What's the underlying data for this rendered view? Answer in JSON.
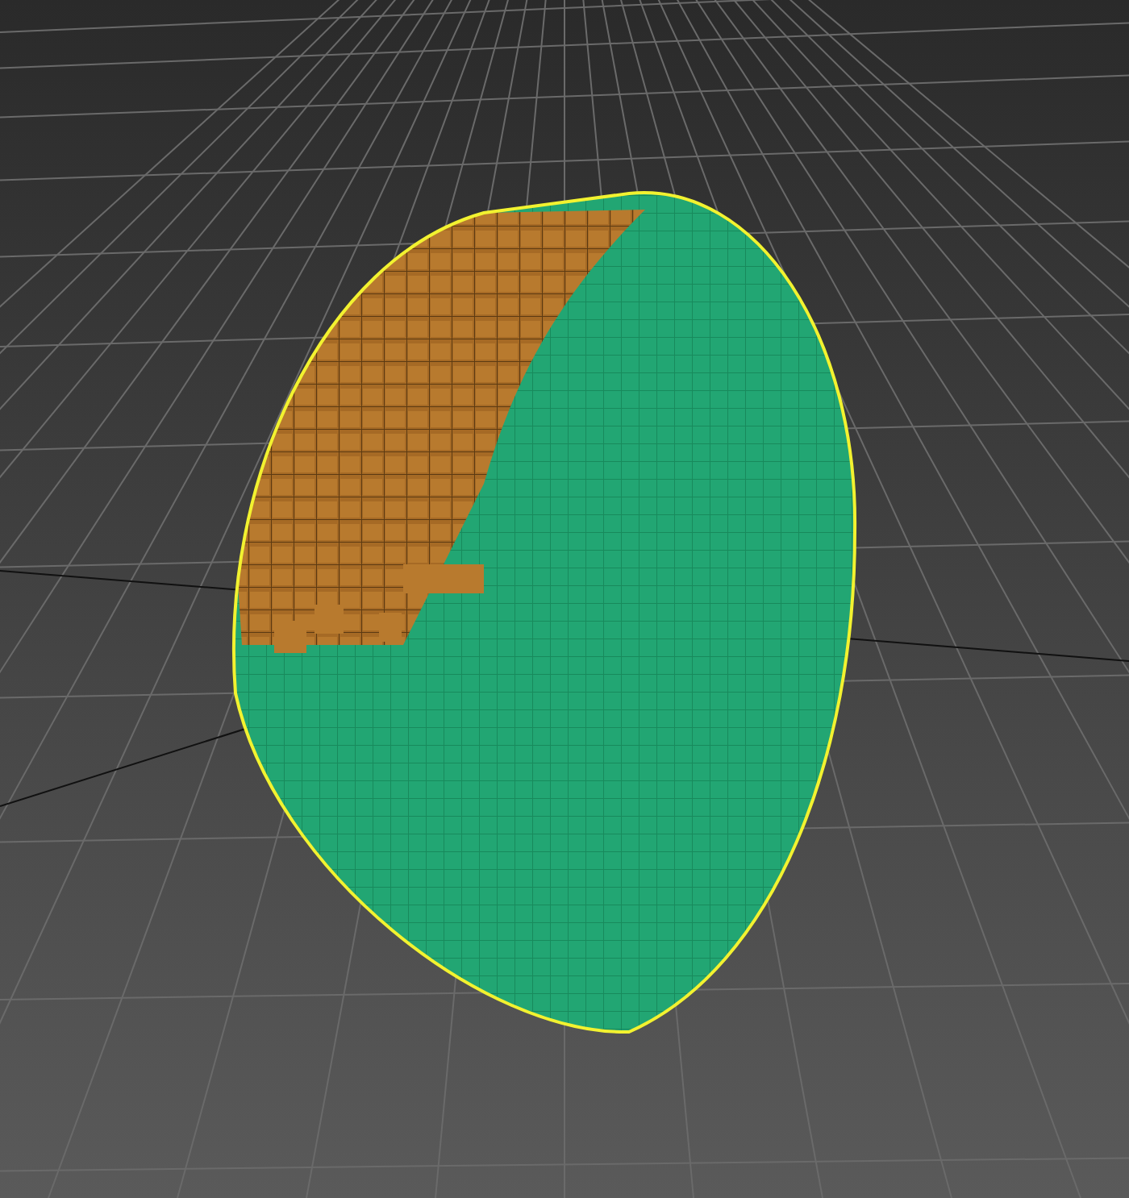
{
  "viewport": {
    "selected_object": {
      "selected": true
    }
  }
}
